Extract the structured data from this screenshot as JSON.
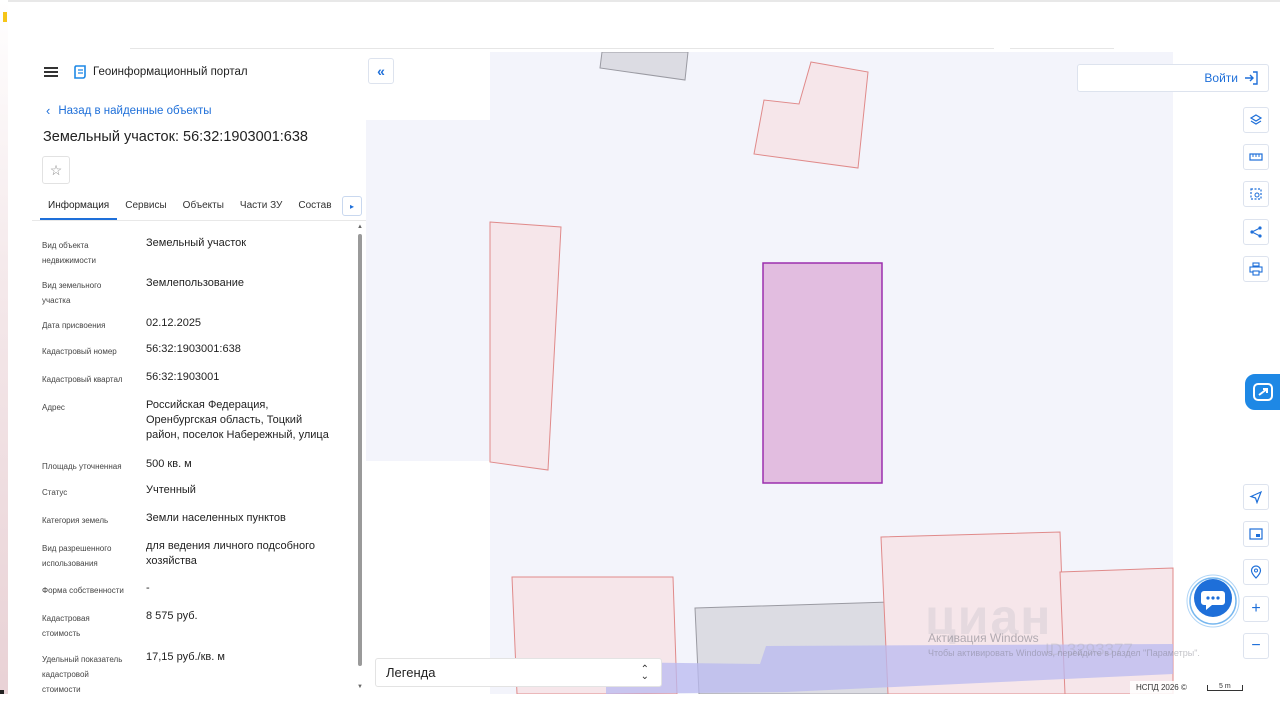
{
  "app": {
    "title": "Геоинформационный портал"
  },
  "nav": {
    "back_label": "Назад в найденные объекты"
  },
  "object": {
    "title": "Земельный участок: 56:32:1903001:638"
  },
  "tabs": [
    {
      "label": "Информация",
      "active": true
    },
    {
      "label": "Сервисы",
      "active": false
    },
    {
      "label": "Объекты",
      "active": false
    },
    {
      "label": "Части ЗУ",
      "active": false
    },
    {
      "label": "Состав",
      "active": false
    }
  ],
  "properties": [
    {
      "key_lines": [
        "Вид объекта",
        "недвижимости"
      ],
      "value_lines": [
        "Земельный участок"
      ]
    },
    {
      "key_lines": [
        "Вид земельного",
        "участка"
      ],
      "value_lines": [
        "Землепользование"
      ]
    },
    {
      "key_lines": [
        "Дата присвоения"
      ],
      "value_lines": [
        "02.12.2025"
      ]
    },
    {
      "key_lines": [
        "Кадастровый номер"
      ],
      "value_lines": [
        "56:32:1903001:638"
      ]
    },
    {
      "key_lines": [
        "Кадастровый квартал"
      ],
      "value_lines": [
        "56:32:1903001"
      ]
    },
    {
      "key_lines": [
        "Адрес"
      ],
      "value_lines": [
        "Российская Федерация,",
        "Оренбургская область, Тоцкий",
        "район, поселок Набережный, улица"
      ]
    },
    {
      "key_lines": [
        "Площадь уточненная"
      ],
      "value_lines": [
        "500 кв. м"
      ]
    },
    {
      "key_lines": [
        "Статус"
      ],
      "value_lines": [
        "Учтенный"
      ]
    },
    {
      "key_lines": [
        "Категория земель"
      ],
      "value_lines": [
        "Земли населенных пунктов"
      ]
    },
    {
      "key_lines": [
        "Вид разрешенного",
        "использования"
      ],
      "value_lines": [
        "для ведения личного подсобного",
        "хозяйства"
      ]
    },
    {
      "key_lines": [
        "Форма собственности"
      ],
      "value_lines": [
        "-"
      ]
    },
    {
      "key_lines": [
        "Кадастровая",
        "стоимость"
      ],
      "value_lines": [
        "8 575 руб."
      ]
    },
    {
      "key_lines": [
        "Удельный показатель",
        "кадастровой",
        "стоимости"
      ],
      "value_lines": [
        "17,15 руб./кв. м"
      ]
    }
  ],
  "map": {
    "login_label": "Войти",
    "legend_label": "Легенда",
    "copyright": "НСПД 2026 ©",
    "scale_label": "5 m",
    "watermark": "циан",
    "watermark_id": "ID 3293377",
    "os_activation_title": "Активация Windows",
    "os_activation_text": "Чтобы активировать Windows, перейдите в раздел \"Параметры\"."
  },
  "colors": {
    "accent": "#1e6fd9",
    "selected_parcel_fill": "#e2bde0",
    "selected_parcel_stroke": "#9b2fae",
    "parcel_fill": "#f3e4ea",
    "parcel_stroke": "#e08a8a",
    "road_fill": "#b9b9f0"
  },
  "icons": {
    "layers": "layers-icon",
    "ruler": "ruler-icon",
    "select_area": "select-area-icon",
    "share": "share-icon",
    "print": "print-icon",
    "locate": "locate-icon",
    "minimap": "minimap-icon",
    "geo": "geo-pin-icon",
    "zoom_in": "+",
    "zoom_out": "−"
  }
}
